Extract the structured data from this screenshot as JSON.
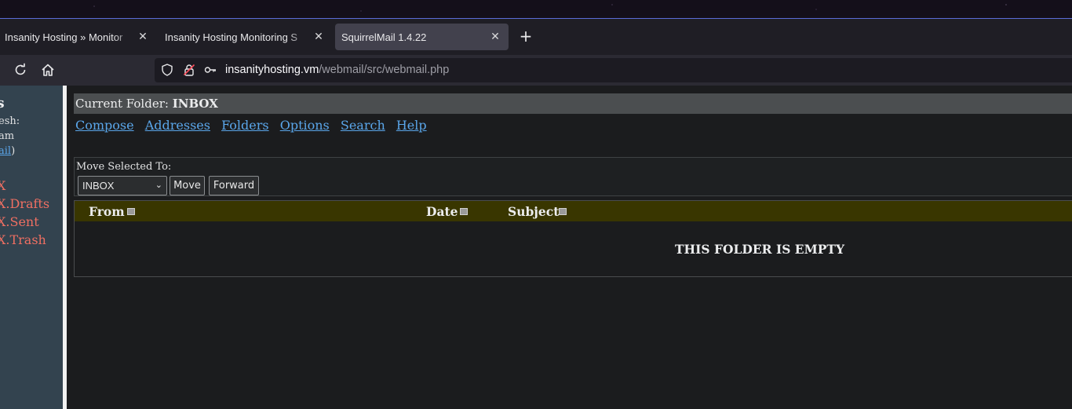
{
  "browser": {
    "tabs": [
      {
        "label": "Insanity Hosting » Monitor",
        "active": false
      },
      {
        "label": "Insanity Hosting Monitoring S",
        "active": false
      },
      {
        "label": "SquirrelMail 1.4.22",
        "active": true
      }
    ],
    "url": {
      "host": "insanityhosting.vm",
      "path": "/webmail/src/webmail.php"
    }
  },
  "sidebar": {
    "title": "rs",
    "refresh_label": "esh:",
    "check_label": "am",
    "check_link": "ail",
    "check_link_close": ")",
    "folders": [
      "X",
      "X.Drafts",
      "X.Sent",
      "X.Trash"
    ]
  },
  "main": {
    "current_folder_label": "Current Folder:",
    "current_folder": "INBOX",
    "menu": [
      "Compose",
      "Addresses",
      "Folders",
      "Options",
      "Search",
      "Help"
    ],
    "move_label": "Move Selected To:",
    "move_select_value": "INBOX",
    "move_button": "Move",
    "forward_button": "Forward",
    "columns": [
      "From",
      "Date",
      "Subject"
    ],
    "empty_message": "THIS FOLDER IS EMPTY"
  },
  "colors": {
    "folder_link": "#ef6f62",
    "link": "#5aa6ea",
    "header_bar": "#393600",
    "folder_bar": "#4b4e50",
    "sidebar_bg": "#33434f"
  },
  "icons": [
    "close-icon",
    "plus-icon",
    "reload-icon",
    "home-icon",
    "shield-icon",
    "insecure-lock-icon",
    "key-icon",
    "chevron-down-icon",
    "sort-icon"
  ]
}
